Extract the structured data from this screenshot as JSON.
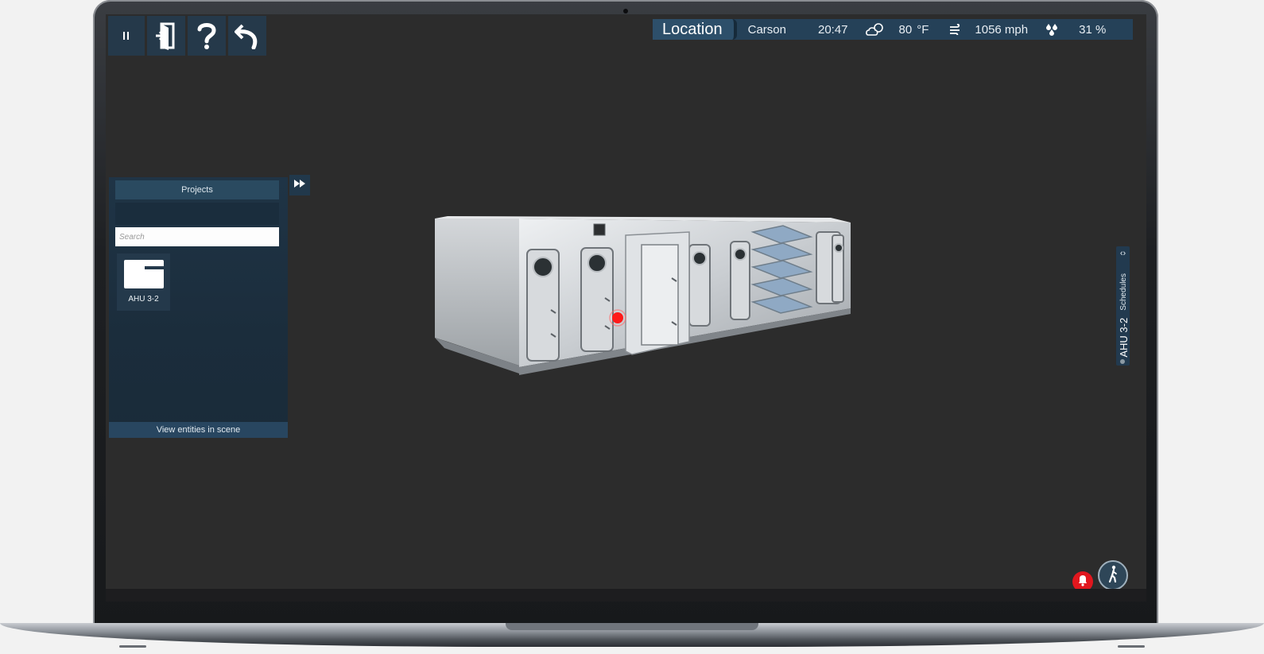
{
  "toolbar": {
    "buttons": [
      {
        "name": "pause-icon"
      },
      {
        "name": "exit-door-icon"
      },
      {
        "name": "help-icon"
      },
      {
        "name": "undo-icon"
      }
    ]
  },
  "status": {
    "location_label": "Location",
    "city": "Carson",
    "time": "20:47",
    "temperature": "80",
    "temperature_unit": "°F",
    "wind": "1056 mph",
    "humidity": "31 %"
  },
  "projects_panel": {
    "title": "Projects",
    "search_placeholder": "Search",
    "items": [
      {
        "label": "AHU 3-2"
      }
    ],
    "footer": "View entities in scene"
  },
  "side_tab": {
    "title": "AHU 3-2",
    "subtitle": "Schedules"
  },
  "colors": {
    "screen_bg": "#2c2c2c",
    "panel_bg": "#1b2d3c",
    "accent_blue": "#254158",
    "alert_red": "#e1171e"
  }
}
